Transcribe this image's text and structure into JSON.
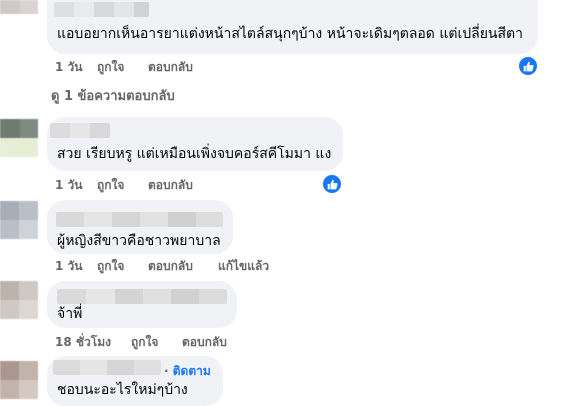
{
  "colors": {
    "bubble_bg": "#f0f2f5",
    "meta_text": "#65676b",
    "link_blue": "#1877f2",
    "text": "#050505"
  },
  "comments": [
    {
      "text": "แอบอยากเห็นอารยาแต่งหน้าสไตล์สนุกๆบ้าง หน้าจะเดิมๆตลอด แต่เปลี่ยนสีตา",
      "time": "1 วัน",
      "like": "ถูกใจ",
      "reply": "ตอบกลับ",
      "reaction_icon": "like-icon"
    },
    {
      "text": "สวย เรียบหรู แต่เหมือนเพิ่งจบคอร์สคีโมมา แง",
      "time": "1 วัน",
      "like": "ถูกใจ",
      "reply": "ตอบกลับ",
      "reaction_icon": "like-icon"
    },
    {
      "text": "ผู้หญิงสีขาวคือชาวพยาบาล",
      "time": "1 วัน",
      "like": "ถูกใจ",
      "reply": "ตอบกลับ",
      "edited": "แก้ไขแล้ว"
    },
    {
      "text": "จ้าพี่",
      "time": "18 ชั่วโมง",
      "like": "ถูกใจ",
      "reply": "ตอบกลับ"
    },
    {
      "text": "ชอบนะอะไรใหม่ๆบ้าง",
      "follow": "ติดตาม"
    }
  ],
  "view_replies": "ดู 1 ข้อความตอบกลับ"
}
